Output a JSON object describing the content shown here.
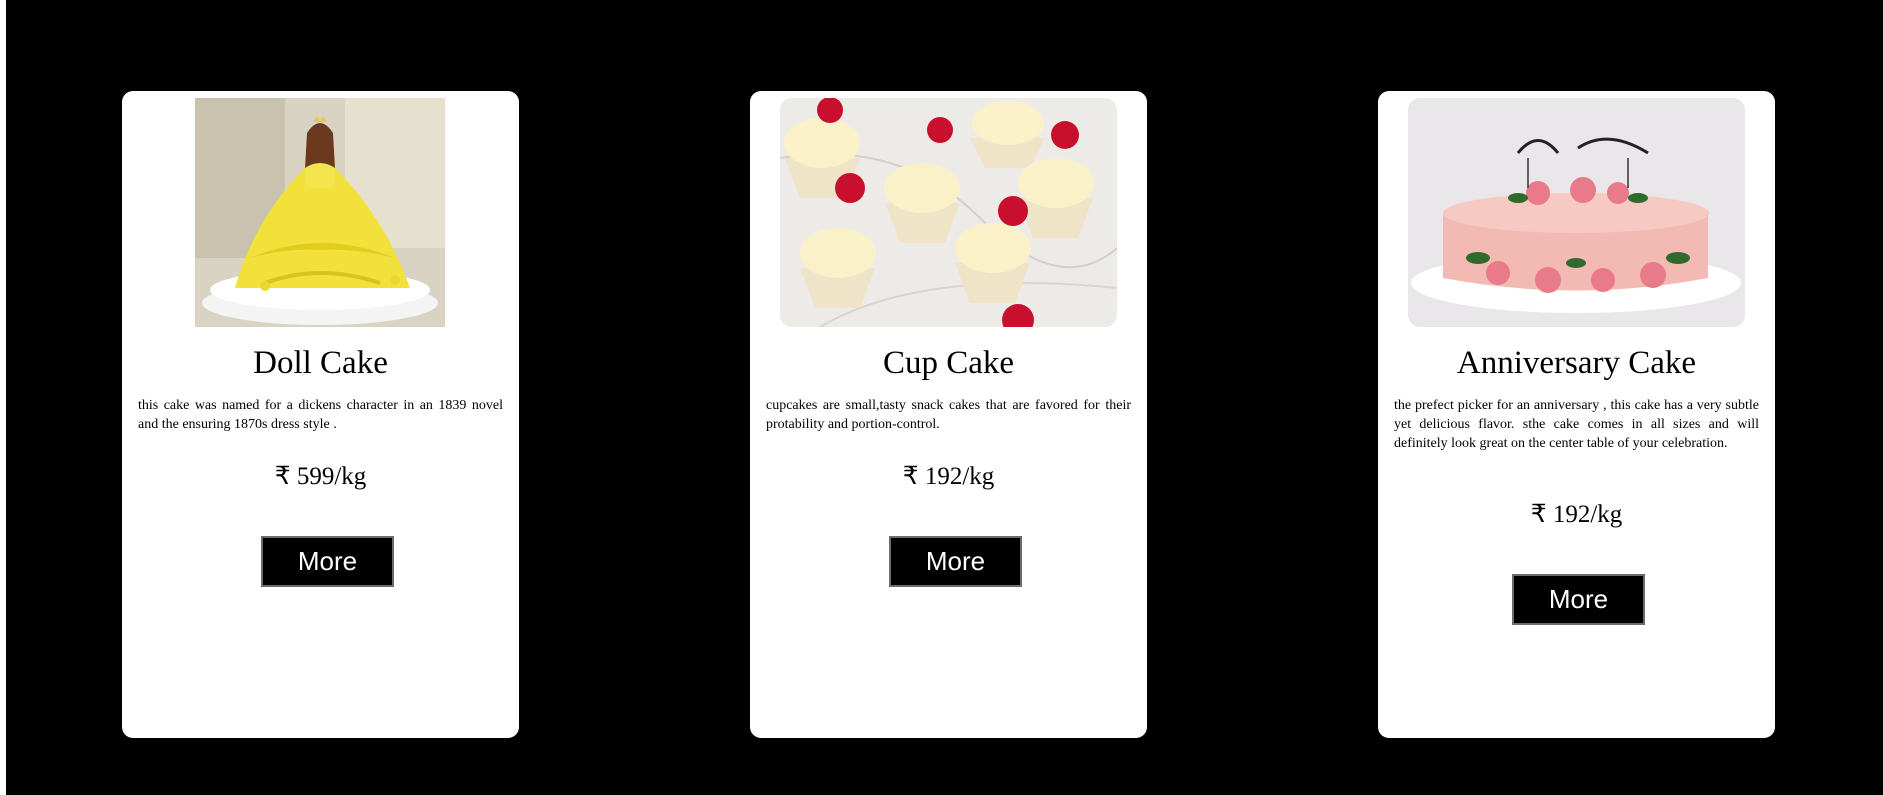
{
  "cards": [
    {
      "image": "doll-cake-photo",
      "title": "Doll Cake",
      "description": "this cake was named for a dickens character in an 1839 novel and the ensuring 1870s dress style .",
      "price": "₹ 599/kg",
      "button_label": "More"
    },
    {
      "image": "cupcake-photo",
      "title": "Cup Cake",
      "description": "cupcakes are small,tasty snack cakes that are favored for their protability and portion-control.",
      "price": "₹ 192/kg",
      "button_label": "More"
    },
    {
      "image": "anniversary-cake-photo",
      "title": "Anniversary Cake",
      "description": "the prefect picker for an anniversary , this cake has a very subtle yet delicious flavor. sthe cake comes in all sizes and will definitely look great on the center table of your celebration.",
      "price": "₹ 192/kg",
      "button_label": "More"
    }
  ],
  "colors": {
    "background": "#000000",
    "card": "#ffffff",
    "button": "#000000",
    "button_text": "#ffffff"
  }
}
